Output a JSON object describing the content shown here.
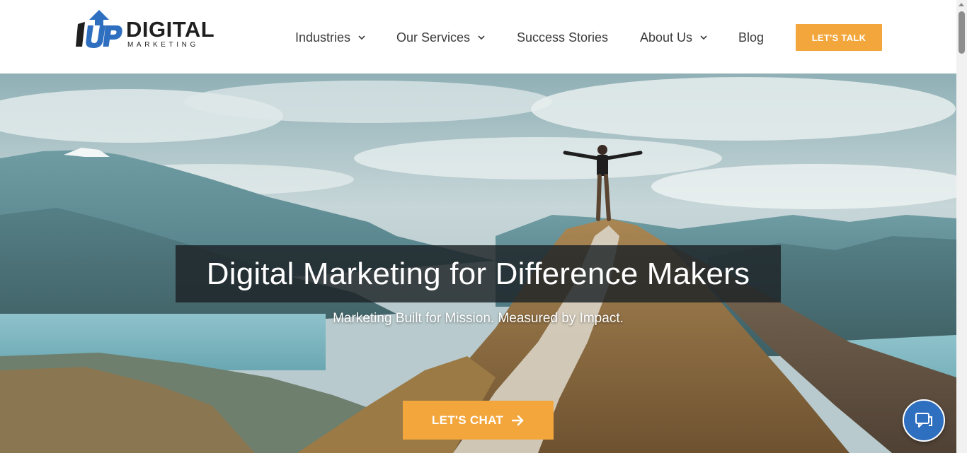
{
  "logo": {
    "word": "DIGITAL",
    "sub": "MARKETING",
    "mark_icon": "1up-arrow-logo-icon"
  },
  "nav": {
    "items": [
      {
        "label": "Industries",
        "has_dropdown": true
      },
      {
        "label": "Our Services",
        "has_dropdown": true
      },
      {
        "label": "Success Stories",
        "has_dropdown": false
      },
      {
        "label": "About Us",
        "has_dropdown": true
      },
      {
        "label": "Blog",
        "has_dropdown": false
      }
    ],
    "cta_label": "LET'S TALK"
  },
  "hero": {
    "headline": "Digital Marketing for Difference Makers",
    "subhead": "Marketing Built for Mission. Measured by Impact.",
    "cta_label": "LET'S CHAT",
    "cta_icon": "arrow-right-icon",
    "background": "mountain-summit-photo"
  },
  "chat_widget": {
    "icon": "chat-bubbles-icon"
  },
  "colors": {
    "accent": "#f3a63b",
    "nav_text": "#3b3b3b",
    "logo_blue": "#2f6fc0",
    "headline_box": "#1c2226",
    "chat_widget": "#2f6fc0"
  }
}
